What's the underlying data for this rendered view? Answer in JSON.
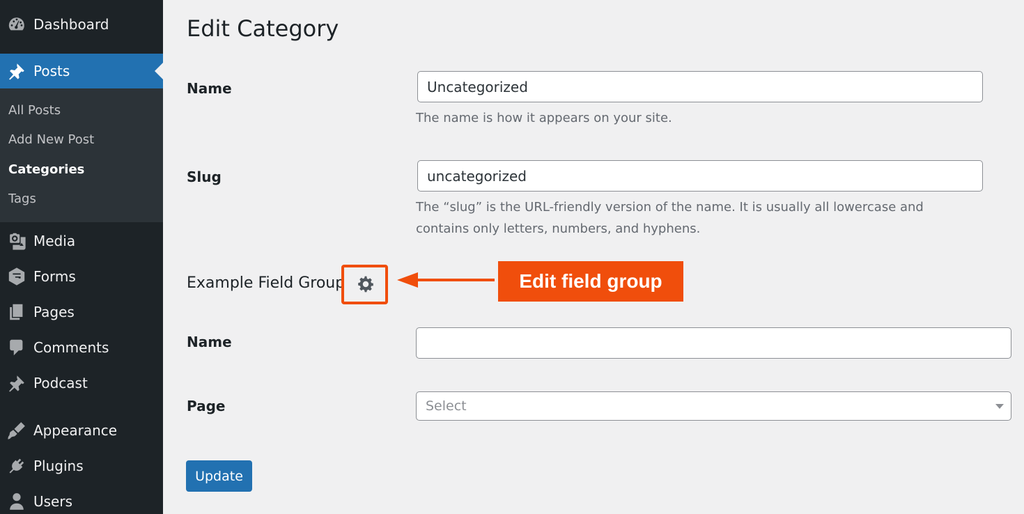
{
  "sidebar": {
    "items": [
      {
        "label": "Dashboard",
        "icon": "dashboard-icon"
      },
      {
        "label": "Posts",
        "icon": "pushpin-icon",
        "active": true
      },
      {
        "label": "Media",
        "icon": "media-icon"
      },
      {
        "label": "Forms",
        "icon": "forms-icon"
      },
      {
        "label": "Pages",
        "icon": "pages-icon"
      },
      {
        "label": "Comments",
        "icon": "comments-icon"
      },
      {
        "label": "Podcast",
        "icon": "pushpin-icon"
      },
      {
        "label": "Appearance",
        "icon": "appearance-icon"
      },
      {
        "label": "Plugins",
        "icon": "plugins-icon"
      },
      {
        "label": "Users",
        "icon": "users-icon"
      }
    ],
    "submenu": [
      {
        "label": "All Posts"
      },
      {
        "label": "Add New Post"
      },
      {
        "label": "Categories",
        "current": true
      },
      {
        "label": "Tags"
      }
    ]
  },
  "main": {
    "title": "Edit Category",
    "name_label": "Name",
    "name_value": "Uncategorized",
    "name_desc": "The name is how it appears on your site.",
    "slug_label": "Slug",
    "slug_value": "uncategorized",
    "slug_desc_line1": "The “slug” is the URL-friendly version of the name. It is usually all lowercase and",
    "slug_desc_line2": "contains only letters, numbers, and hyphens.",
    "field_group": {
      "title": "Example Field Group",
      "name_label": "Name",
      "name_value": "",
      "page_label": "Page",
      "page_placeholder": "Select"
    },
    "update_label": "Update"
  },
  "annotation": {
    "callout_text": "Edit field group",
    "color": "#f04e0c"
  },
  "colors": {
    "sidebar_bg": "#1d2327",
    "submenu_bg": "#2c3338",
    "accent": "#2271b1",
    "page_bg": "#f0f0f1"
  }
}
